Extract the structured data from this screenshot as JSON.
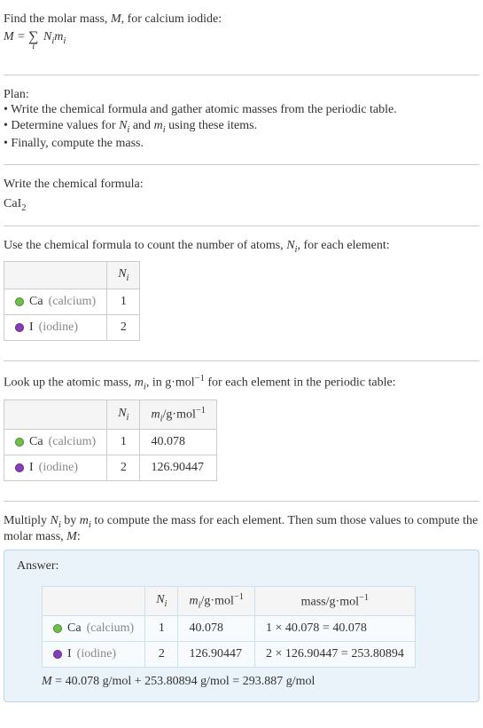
{
  "intro": {
    "line1_pre": "Find the molar mass, ",
    "line1_var": "M",
    "line1_post": ", for calcium iodide:",
    "eq_lhs": "M",
    "eq_eq": " = ",
    "sigma": "∑",
    "sigma_under": "i",
    "eq_rhs_N": "N",
    "eq_rhs_i1": "i",
    "eq_rhs_m": "m",
    "eq_rhs_i2": "i"
  },
  "plan": {
    "header": "Plan:",
    "item1_pre": "• Write the chemical formula and gather atomic masses from the periodic table.",
    "item2_pre": "• Determine values for ",
    "item2_N": "N",
    "item2_i1": "i",
    "item2_mid": " and ",
    "item2_m": "m",
    "item2_i2": "i",
    "item2_post": " using these items.",
    "item3": "• Finally, compute the mass."
  },
  "step_formula": {
    "header": "Write the chemical formula:",
    "sym_ca": "Ca",
    "sym_i": "I",
    "sym_sub": "2"
  },
  "step_count": {
    "header_pre": "Use the chemical formula to count the number of atoms, ",
    "header_N": "N",
    "header_i": "i",
    "header_post": ", for each element:",
    "col_blank": "",
    "col_N": "N",
    "col_N_i": "i",
    "row_ca_sym": "Ca",
    "row_ca_name": " (calcium)",
    "row_ca_n": "1",
    "row_i_sym": "I",
    "row_i_name": " (iodine)",
    "row_i_n": "2"
  },
  "step_mass": {
    "header_pre": "Look up the atomic mass, ",
    "header_m": "m",
    "header_i": "i",
    "header_mid": ", in g·mol",
    "header_exp": "−1",
    "header_post": " for each element in the periodic table:",
    "col_m": "m",
    "col_m_i": "i",
    "col_m_unit": "/g·mol",
    "col_m_exp": "−1",
    "row_ca_m": "40.078",
    "row_i_m": "126.90447"
  },
  "step_compute": {
    "header_pre": "Multiply ",
    "header_N": "N",
    "header_Ni": "i",
    "header_by": " by ",
    "header_m": "m",
    "header_mi": "i",
    "header_mid": " to compute the mass for each element. Then sum those values to compute the molar mass, ",
    "header_M": "M",
    "header_post": ":"
  },
  "answer": {
    "label": "Answer:",
    "col_mass": "mass/g·mol",
    "col_mass_exp": "−1",
    "row_ca_calc": "1 × 40.078 = 40.078",
    "row_i_calc": "2 × 126.90447 = 253.80894",
    "final_M": "M",
    "final_text": " = 40.078 g/mol + 253.80894 g/mol = 293.887 g/mol"
  }
}
